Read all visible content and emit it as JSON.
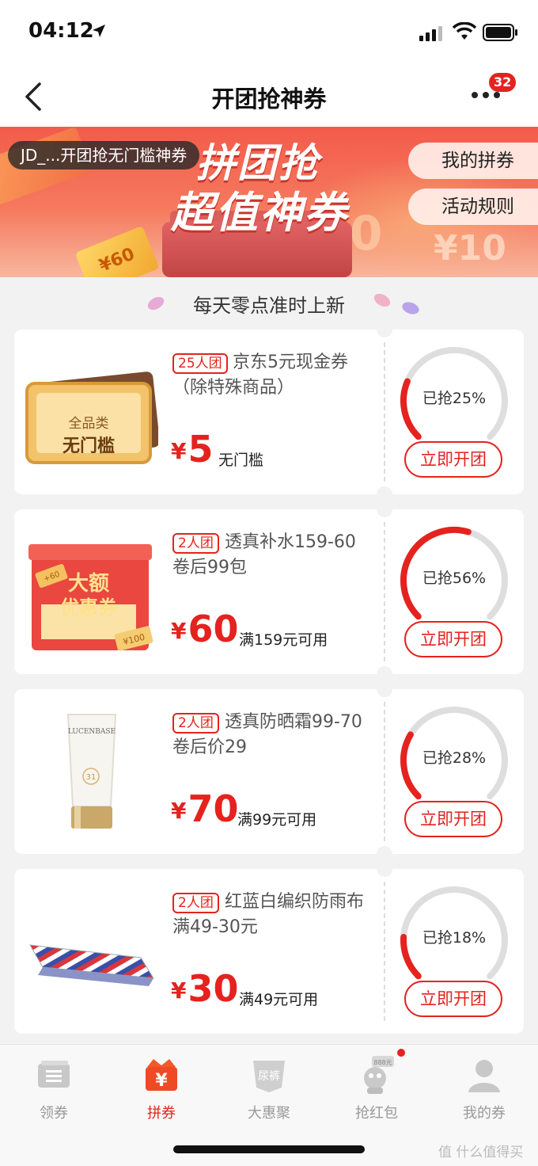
{
  "status_bar": {
    "time": "04:12"
  },
  "nav": {
    "title": "开团抢神券",
    "badge": "32"
  },
  "banner": {
    "line1": "拼团抢",
    "line2": "超值神券",
    "ticket_text": "¥60",
    "coin_text": "10",
    "coin_text2": "¥10",
    "scroll_text": "JD_...开团抢无门槛神券",
    "my_coupons": "我的拼券",
    "rules": "活动规则"
  },
  "subtitle": "每天零点准时上新",
  "cards": [
    {
      "tag": "25人团",
      "title": "京东5元现金券（除特殊商品）",
      "price": "5",
      "condition": "无门槛",
      "progress_text": "已抢25%",
      "progress": 0.25,
      "button": "立即开团",
      "thumb_line1": "全品类",
      "thumb_line2": "无门槛"
    },
    {
      "tag": "2人团",
      "title": "透真补水159-60卷后99包",
      "price": "60",
      "condition": "满159元可用",
      "progress_text": "已抢56%",
      "progress": 0.56,
      "button": "立即开团",
      "thumb_line1": "大额",
      "thumb_line2": "优惠券",
      "thumb_small1": "+60",
      "thumb_small2": "¥100"
    },
    {
      "tag": "2人团",
      "title": "透真防晒霜99-70卷后价29",
      "price": "70",
      "condition": "满99元可用",
      "progress_text": "已抢28%",
      "progress": 0.28,
      "button": "立即开团",
      "thumb_brand": "LUCENBASE",
      "thumb_spf": "31"
    },
    {
      "tag": "2人团",
      "title": "红蓝白编织防雨布满49-30元",
      "price": "30",
      "condition": "满49元可用",
      "progress_text": "已抢18%",
      "progress": 0.18,
      "button": "立即开团"
    }
  ],
  "tabbar": [
    {
      "label": "领券",
      "icon": "coupon-icon"
    },
    {
      "label": "拼券",
      "icon": "yen-bag-icon",
      "icon_text": "¥"
    },
    {
      "label": "大惠聚",
      "icon": "diaper-icon",
      "icon_text": "尿裤"
    },
    {
      "label": "抢红包",
      "icon": "red-packet-mascot-icon",
      "icon_text": "888元"
    },
    {
      "label": "我的券",
      "icon": "person-icon"
    }
  ],
  "watermark": "值 什么值得买",
  "colors": {
    "accent": "#e4231f",
    "track": "#dedede",
    "page_bg": "#f2f2f2"
  }
}
